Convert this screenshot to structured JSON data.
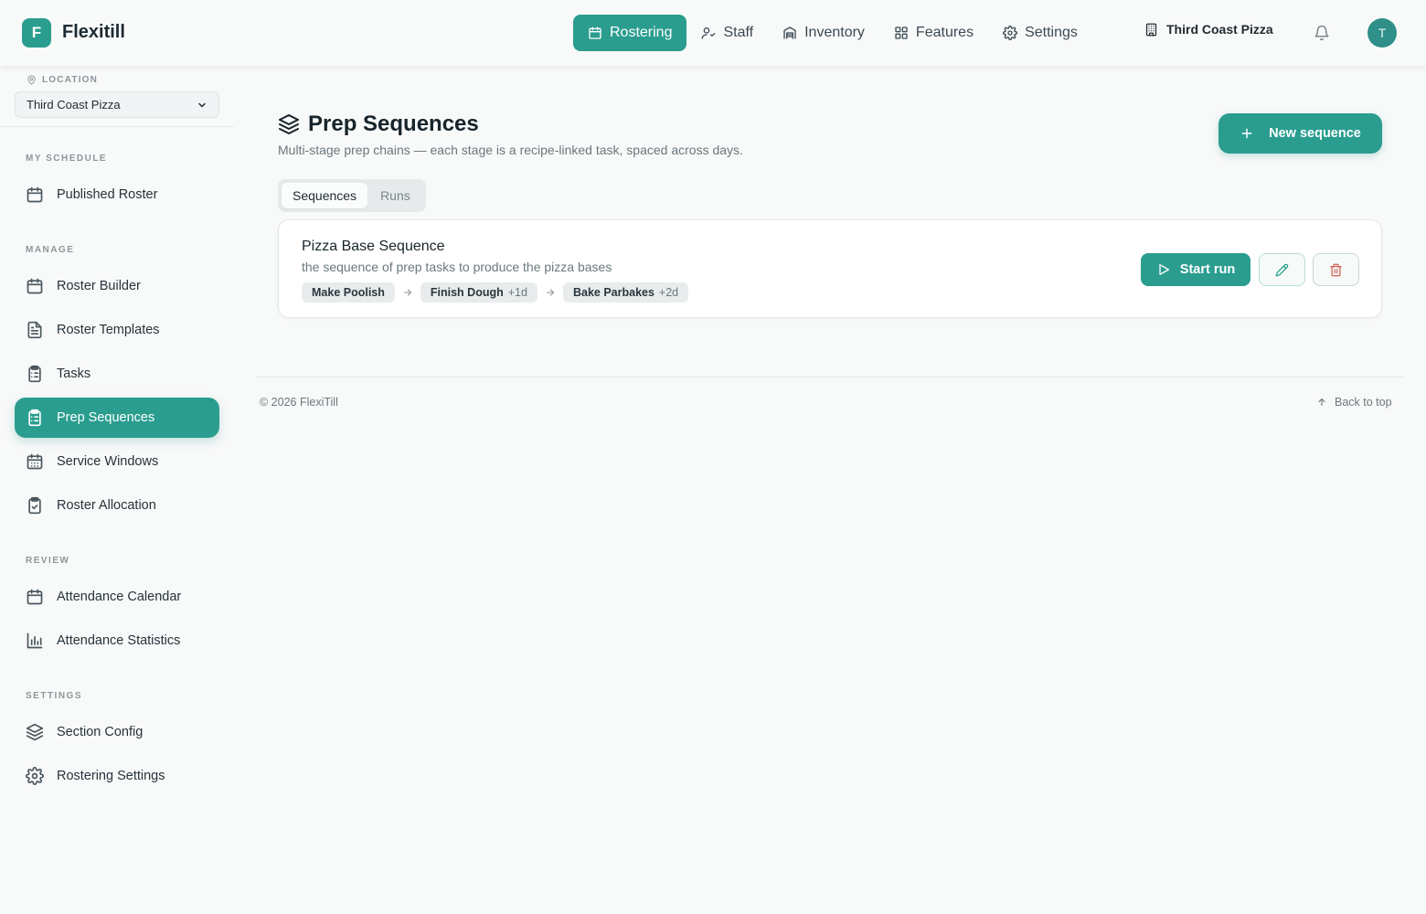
{
  "brand": {
    "logo_letter": "F",
    "name": "Flexitill",
    "accent": "#2a9d8f"
  },
  "topnav": {
    "items": [
      {
        "label": "Rostering",
        "icon": "calendar-icon",
        "active": true
      },
      {
        "label": "Staff",
        "icon": "user-icon"
      },
      {
        "label": "Inventory",
        "icon": "warehouse-icon"
      },
      {
        "label": "Features",
        "icon": "grid-icon"
      },
      {
        "label": "Settings",
        "icon": "gear-icon"
      }
    ],
    "location": "Third Coast Pizza",
    "avatar_letter": "T"
  },
  "sidebar": {
    "location_label": "LOCATION",
    "location_value": "Third Coast Pizza",
    "groups": {
      "my_schedule": "MY SCHEDULE",
      "manage": "MANAGE",
      "review": "REVIEW",
      "settings": "SETTINGS"
    },
    "items": {
      "published_roster": "Published Roster",
      "roster_builder": "Roster Builder",
      "roster_templates": "Roster Templates",
      "tasks": "Tasks",
      "prep_sequences": "Prep Sequences",
      "service_windows": "Service Windows",
      "roster_allocation": "Roster Allocation",
      "attendance_calendar": "Attendance Calendar",
      "attendance_statistics": "Attendance Statistics",
      "section_config": "Section Config",
      "rostering_settings": "Rostering Settings"
    }
  },
  "main": {
    "title": "Prep Sequences",
    "subtitle": "Multi-stage prep chains — each stage is a recipe-linked task, spaced across days.",
    "new_button": "New sequence",
    "tabs": [
      "Sequences",
      "Runs"
    ],
    "sequence": {
      "name": "Pizza Base Sequence",
      "description": "the sequence of prep tasks to produce the pizza bases",
      "stages": [
        {
          "name": "Make Poolish",
          "offset": ""
        },
        {
          "name": "Finish Dough",
          "offset": "+1d"
        },
        {
          "name": "Bake Parbakes",
          "offset": "+2d"
        }
      ],
      "start_button": "Start run"
    }
  },
  "footer": {
    "copyright": "© 2026 FlexiTill",
    "back_to_top": "Back to top"
  }
}
